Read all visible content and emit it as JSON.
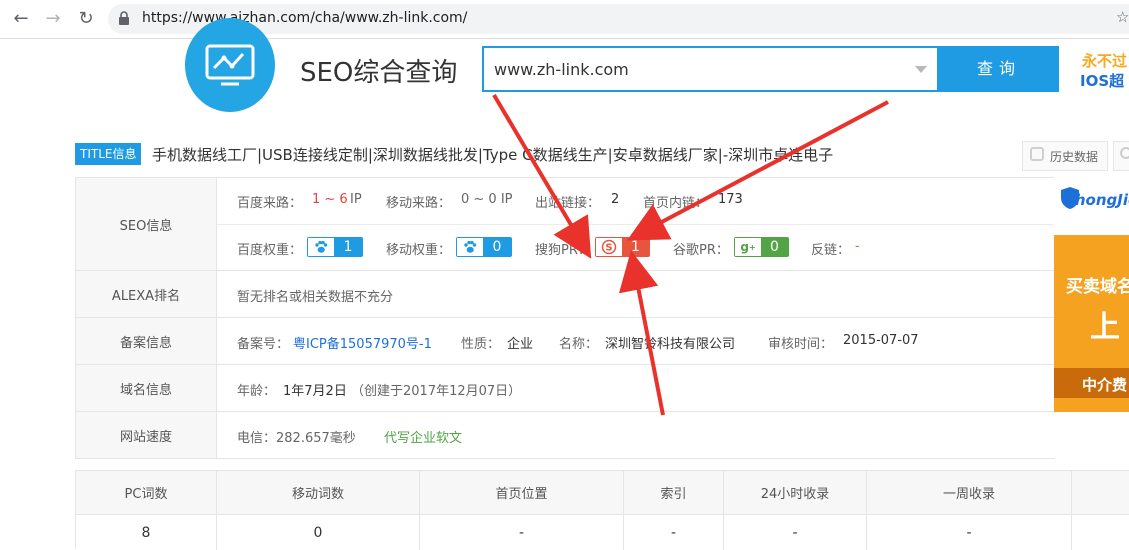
{
  "browser": {
    "url": "https://www.aizhan.com/cha/www.zh-link.com/",
    "back_icon": "back-arrow-icon",
    "forward_icon": "forward-arrow-icon",
    "reload_icon": "reload-icon"
  },
  "header": {
    "site_title": "SEO综合查询",
    "search_value": "www.zh-link.com",
    "search_button": "查询",
    "ad_top_line1": "永不过",
    "ad_top_line2": "IOS超"
  },
  "title_info": {
    "badge": "TITLE信息",
    "text": "手机数据线工厂|USB连接线定制|深圳数据线批发|Type C数据线生产|安卓数据线厂家|-深圳市卓连电子",
    "history_label": "历史数据"
  },
  "seo": {
    "head": "SEO信息",
    "baidu_source_label": "百度来路：",
    "baidu_source_value": "1 ~ 6",
    "baidu_source_unit": "IP",
    "mobile_source_label": "移动来路：",
    "mobile_source_value": "0 ~ 0 IP",
    "outlinks_label": "出站链接：",
    "outlinks_value": "2",
    "home_internal_label": "首页内链：",
    "home_internal_value": "173",
    "baidu_weight_label": "百度权重：",
    "baidu_weight_value": "1",
    "mobile_weight_label": "移动权重：",
    "mobile_weight_value": "0",
    "sogou_pr_label": "搜狗PR：",
    "sogou_pr_value": "1",
    "google_pr_label": "谷歌PR：",
    "google_pr_value": "0",
    "backlinks_label": "反链：",
    "backlinks_value": "-"
  },
  "alexa": {
    "head": "ALEXA排名",
    "text": "暂无排名或相关数据不充分"
  },
  "beian": {
    "head": "备案信息",
    "number_label": "备案号：",
    "number_value": "粤ICP备15057970号-1",
    "nature_label": "性质：",
    "nature_value": "企业",
    "name_label": "名称：",
    "name_value": "深圳智铃科技有限公司",
    "audit_label": "审核时间：",
    "audit_value": "2015-07-07"
  },
  "domain": {
    "head": "域名信息",
    "age_label": "年龄：",
    "age_value": "1年7月2日",
    "created": "（创建于2017年12月07日）"
  },
  "speed": {
    "head": "网站速度",
    "telecom": "电信：282.657毫秒",
    "link": "代写企业软文"
  },
  "ad_right": {
    "logo": "ZhongJie",
    "line1": "买卖域名",
    "line2": "上",
    "line3": "中介费"
  },
  "bottom_table": {
    "headers": [
      "PC词数",
      "移动词数",
      "首页位置",
      "索引",
      "24小时收录",
      "一周收录",
      ""
    ],
    "values": [
      "8",
      "0",
      "-",
      "-",
      "-",
      "-",
      ""
    ]
  },
  "colors": {
    "accent": "#1e9be3",
    "red": "#e8553e",
    "green": "#52a447",
    "annotation_arrow": "#e8322b"
  }
}
